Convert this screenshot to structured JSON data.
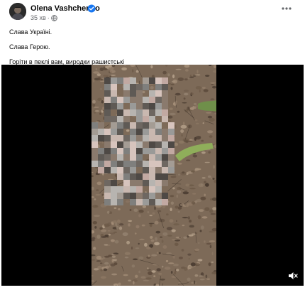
{
  "post": {
    "author": "Olena Vashchenko",
    "timestamp": "35 хв",
    "verified_icon": "verified-badge-icon",
    "privacy_icon": "globe-icon",
    "more_icon": "more-options-icon",
    "text_lines": [
      "Слава Україні.",
      "Слава Герою.",
      "Горіти в пеклі вам, виродки рашистські"
    ]
  },
  "video": {
    "content": "pixelated-video-frame",
    "mute_icon": "mute-icon"
  },
  "colors": {
    "accent": "#1877f2",
    "secondary_text": "#65676b",
    "video_background": "#000000"
  }
}
